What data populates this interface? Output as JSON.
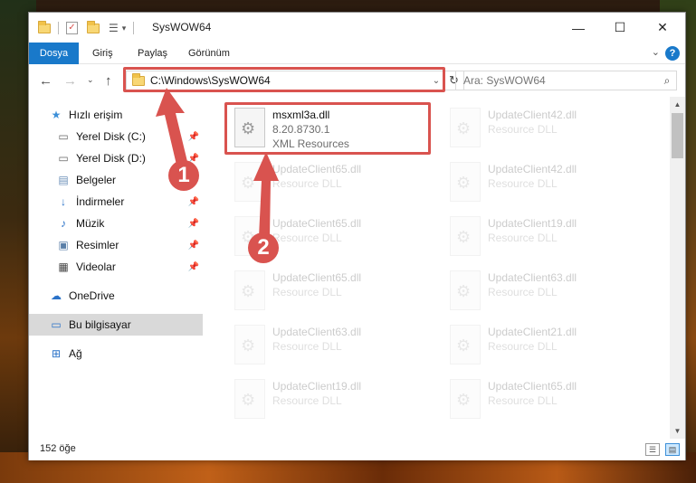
{
  "window": {
    "title": "SysWOW64",
    "controls": {
      "minimize": "—",
      "maximize": "☐",
      "close": "✕"
    }
  },
  "ribbon": {
    "tabs": [
      "Dosya",
      "Giriş",
      "Paylaş",
      "Görünüm"
    ],
    "help": "?"
  },
  "address": {
    "path": "C:\\Windows\\SysWOW64",
    "search_placeholder": "Ara: SysWOW64"
  },
  "sidebar": {
    "items": [
      {
        "label": "Hızlı erişim",
        "icon": "star-icon",
        "pinned": false
      },
      {
        "label": "Yerel Disk (C:)",
        "icon": "drive-icon",
        "pinned": true
      },
      {
        "label": "Yerel Disk (D:)",
        "icon": "drive-icon",
        "pinned": true
      },
      {
        "label": "Belgeler",
        "icon": "documents-icon",
        "pinned": true
      },
      {
        "label": "İndirmeler",
        "icon": "download-icon",
        "pinned": true
      },
      {
        "label": "Müzik",
        "icon": "music-icon",
        "pinned": true
      },
      {
        "label": "Resimler",
        "icon": "pictures-icon",
        "pinned": true
      },
      {
        "label": "Videolar",
        "icon": "videos-icon",
        "pinned": true
      },
      {
        "label": "OneDrive",
        "icon": "cloud-icon",
        "pinned": false
      },
      {
        "label": "Bu bilgisayar",
        "icon": "computer-icon",
        "pinned": false
      },
      {
        "label": "Ağ",
        "icon": "network-icon",
        "pinned": false
      }
    ]
  },
  "files": [
    {
      "name": "msxml3a.dll",
      "version": "8.20.8730.1",
      "type": "XML Resources",
      "highlighted": true
    },
    {
      "name": "UpdateClient42.dll",
      "type": "Resource DLL"
    },
    {
      "name": "UpdateClient65.dll",
      "type": "Resource DLL"
    },
    {
      "name": "UpdateClient42.dll",
      "type": "Resource DLL"
    },
    {
      "name": "UpdateClient65.dll",
      "type": "Resource DLL"
    },
    {
      "name": "UpdateClient19.dll",
      "type": "Resource DLL"
    },
    {
      "name": "UpdateClient65.dll",
      "type": "Resource DLL"
    },
    {
      "name": "UpdateClient63.dll",
      "type": "Resource DLL"
    },
    {
      "name": "UpdateClient63.dll",
      "type": "Resource DLL"
    },
    {
      "name": "UpdateClient21.dll",
      "type": "Resource DLL"
    },
    {
      "name": "UpdateClient19.dll",
      "type": "Resource DLL"
    },
    {
      "name": "UpdateClient65.dll",
      "type": "Resource DLL"
    }
  ],
  "status": {
    "item_count": "152 öğe"
  },
  "annotations": {
    "step1": "1",
    "step2": "2",
    "color": "#d9534f"
  }
}
